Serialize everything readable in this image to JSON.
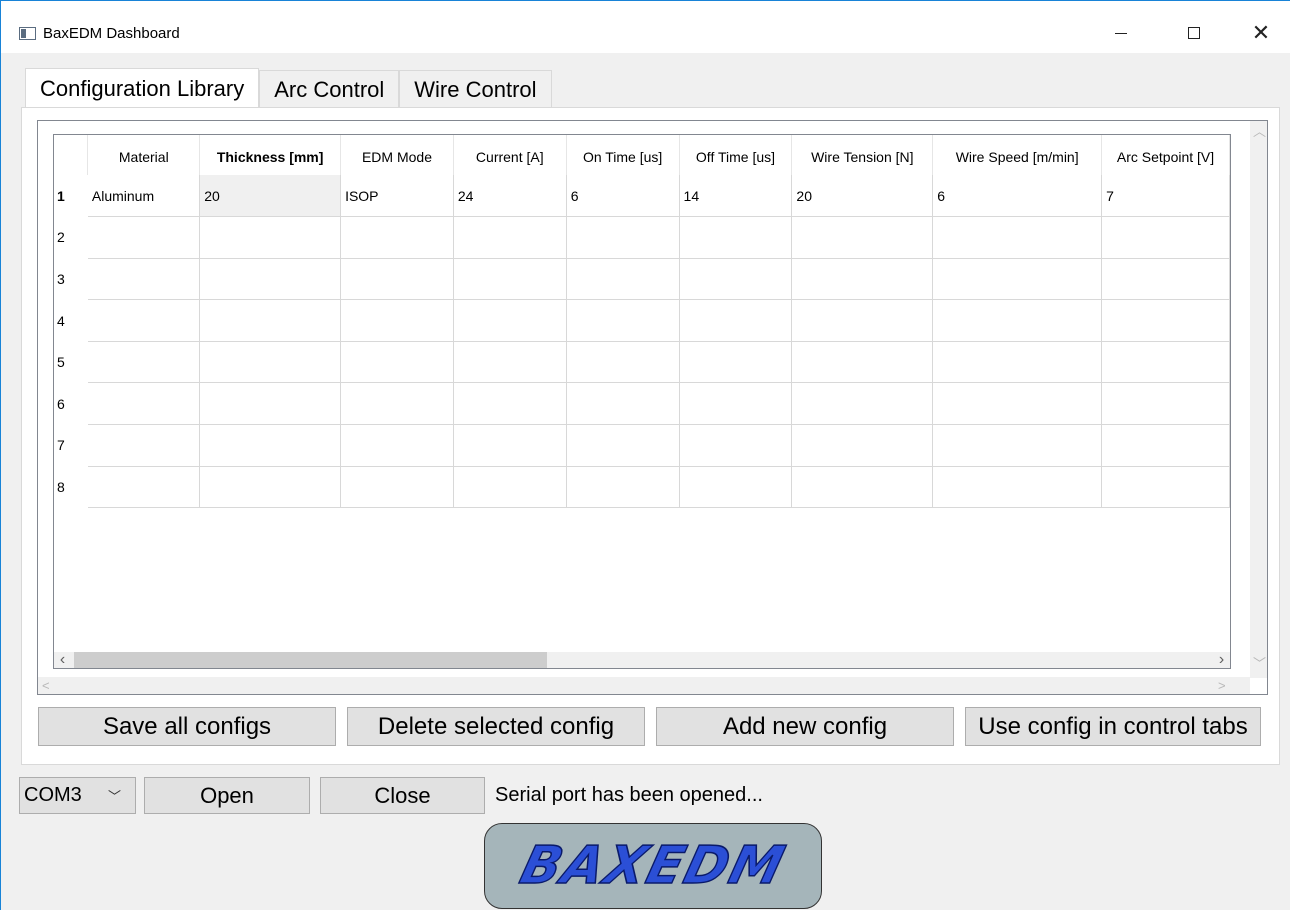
{
  "window": {
    "title": "BaxEDM Dashboard"
  },
  "tabs": [
    {
      "label": "Configuration Library",
      "active": true
    },
    {
      "label": "Arc Control",
      "active": false
    },
    {
      "label": "Wire Control",
      "active": false
    }
  ],
  "table": {
    "columns": [
      "Material",
      "Thickness [mm]",
      "EDM Mode",
      "Current [A]",
      "On Time [us]",
      "Off Time [us]",
      "Wire Tension [N]",
      "Wire Speed [m/min]",
      "Arc Setpoint [V]"
    ],
    "row_numbers": [
      "1",
      "2",
      "3",
      "4",
      "5",
      "6",
      "7",
      "8"
    ],
    "rows": [
      [
        "Aluminum",
        "20",
        "ISOP",
        "24",
        "6",
        "14",
        "20",
        "6",
        "7"
      ],
      [
        "",
        "",
        "",
        "",
        "",
        "",
        "",
        "",
        ""
      ],
      [
        "",
        "",
        "",
        "",
        "",
        "",
        "",
        "",
        ""
      ],
      [
        "",
        "",
        "",
        "",
        "",
        "",
        "",
        "",
        ""
      ],
      [
        "",
        "",
        "",
        "",
        "",
        "",
        "",
        "",
        ""
      ],
      [
        "",
        "",
        "",
        "",
        "",
        "",
        "",
        "",
        ""
      ],
      [
        "",
        "",
        "",
        "",
        "",
        "",
        "",
        "",
        ""
      ],
      [
        "",
        "",
        "",
        "",
        "",
        "",
        "",
        "",
        ""
      ]
    ],
    "bold_column": "Thickness [mm]",
    "selected_row": "1"
  },
  "actions": {
    "save_label": "Save all configs",
    "delete_label": "Delete selected config",
    "add_label": "Add new config",
    "use_label": "Use config in control tabs"
  },
  "serial": {
    "port": "COM3",
    "open_label": "Open",
    "close_label": "Close",
    "status": "Serial port has been opened..."
  },
  "logo": {
    "text": "BAXEDM"
  },
  "icons": {
    "minimize": "minimize-icon",
    "maximize": "maximize-icon",
    "close": "close-icon"
  }
}
